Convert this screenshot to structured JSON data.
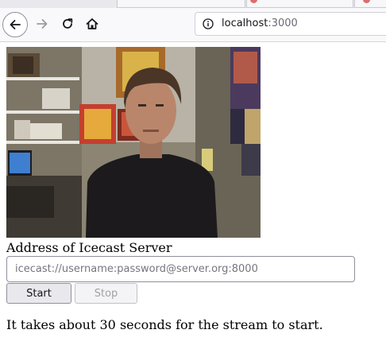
{
  "browser": {
    "url_host": "localhost",
    "url_port": ":3000",
    "icons": {
      "back": "back-arrow-icon",
      "forward": "forward-arrow-icon",
      "reload": "reload-icon",
      "home": "home-icon",
      "site_info": "info-icon"
    }
  },
  "page": {
    "video_description_icon": "webcam-video",
    "server_label": "Address of Icecast Server",
    "server_input_value": "",
    "server_input_placeholder": "icecast://username:password@server.org:8000",
    "start_label": "Start",
    "stop_label": "Stop",
    "stop_disabled": true,
    "note": "It takes about 30 seconds for the stream to start."
  }
}
